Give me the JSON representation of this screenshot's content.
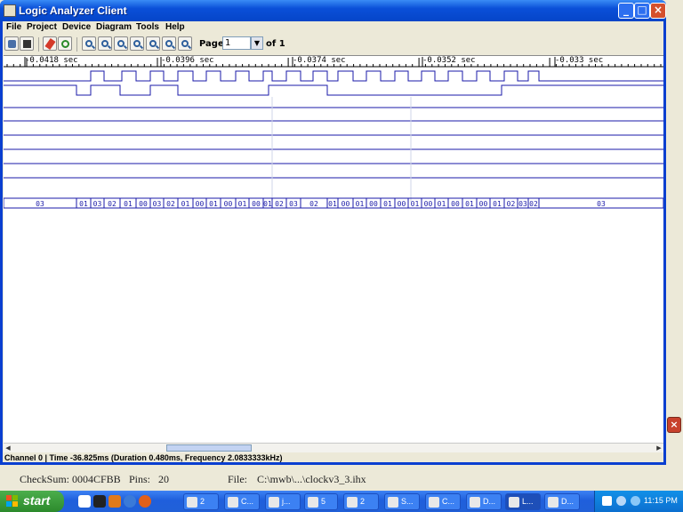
{
  "window": {
    "title": "Logic Analyzer Client"
  },
  "menu": [
    "File",
    "Project",
    "Device",
    "Diagram",
    "Tools",
    "Help"
  ],
  "toolbar": {
    "page_label": "Page",
    "page_value": "1",
    "page_of": "of 1"
  },
  "ruler": {
    "labels": [
      "-0.0418 sec",
      "-0.0396 sec",
      "-0.0374 sec",
      "-0.0352 sec",
      "-0.033 sec"
    ]
  },
  "bus": {
    "values": [
      "03",
      "01",
      "03",
      "02",
      "01",
      "00",
      "03",
      "02",
      "01",
      "00",
      "01",
      "00",
      "01",
      "00",
      "01",
      "02",
      "03",
      "02",
      "01",
      "00",
      "01",
      "00",
      "01",
      "00",
      "01",
      "00",
      "01",
      "00",
      "01",
      "00",
      "01",
      "02",
      "03",
      "02",
      "03"
    ]
  },
  "status": {
    "text": "Channel 0 | Time -36.825ms (Duration 0.480ms, Frequency 2.0833333kHz)"
  },
  "background_app": {
    "checksum_label": "CheckSum: 0004CFBB",
    "pins_label": "Pins:",
    "pins_value": "20",
    "file_label": "File:",
    "file_value": "C:\\mwb\\...\\clockv3_3.ihx"
  },
  "taskbar": {
    "start_label": "start",
    "tasks": [
      "2",
      "C...",
      "j...",
      "5",
      "2",
      "S...",
      "C...",
      "D...",
      "L...",
      "D..."
    ],
    "clock": "11:15 PM"
  },
  "colors": {
    "signal": "#1a1aa8",
    "titlebar": "#0a4fd8",
    "start": "#3a9a3a"
  }
}
